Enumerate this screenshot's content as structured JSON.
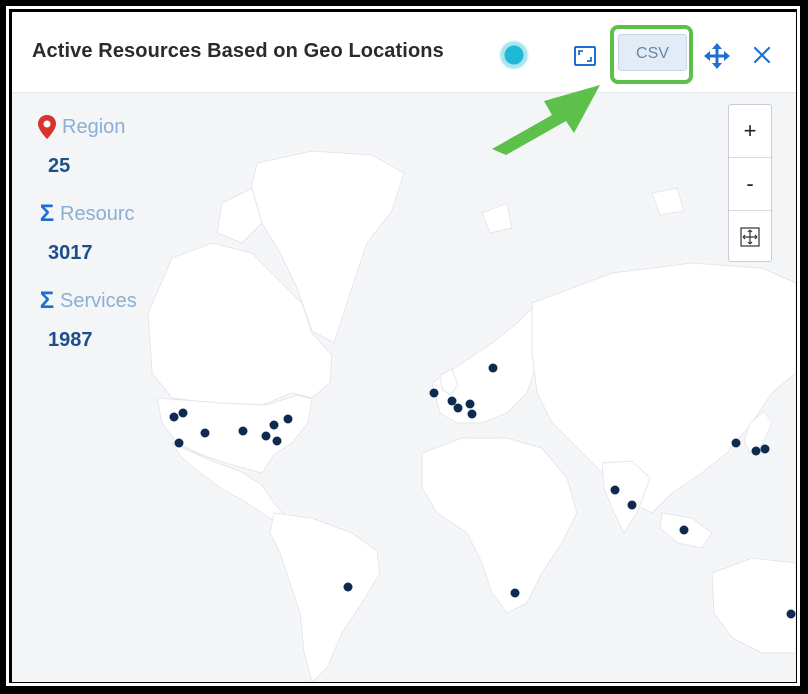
{
  "widget": {
    "title": "Active Resources Based on Geo Locations",
    "csv_label": "CSV",
    "zoom_in_label": "+",
    "zoom_out_label": "-"
  },
  "stats": [
    {
      "icon": "map-pin-icon",
      "label": "Region",
      "value": "25"
    },
    {
      "icon": "sigma-icon",
      "label": "Resourc",
      "value": "3017"
    },
    {
      "icon": "sigma-icon",
      "label": "Services",
      "value": "1987"
    }
  ],
  "colors": {
    "accent": "#1c4e8a",
    "label": "#8aaed4",
    "highlight": "#5cc04a",
    "marker": "#0f2a4f",
    "status": "#1fb8d6"
  }
}
